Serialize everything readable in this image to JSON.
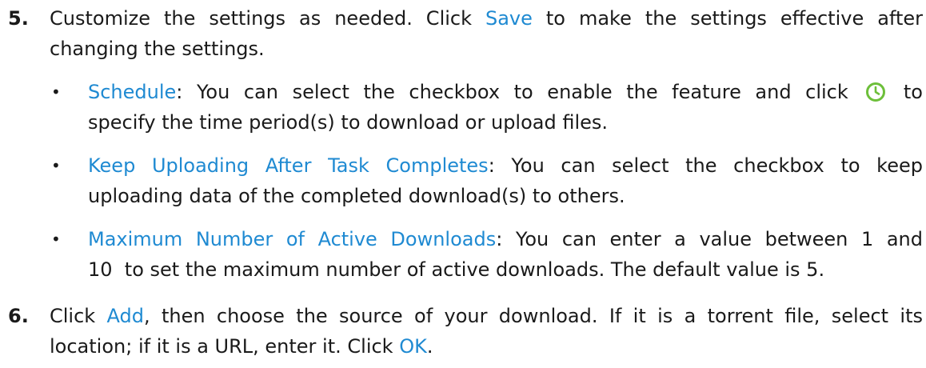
{
  "step5": {
    "number": "5.",
    "line1_a": "Customize the settings as needed. Click ",
    "line1_link": "Save",
    "line1_b": " to make the settings effective after",
    "line2": "changing the settings."
  },
  "bullets": [
    {
      "label": "Schedule",
      "line1_a": ": You can select the checkbox to enable the feature and click ",
      "icon": "clock-icon",
      "line1_b": " to",
      "line2": "specify the time period(s) to download or upload files."
    },
    {
      "label": "Keep Uploading After Task Completes",
      "line1_a": ": You can select the checkbox to keep",
      "line2": "uploading data of the completed download(s) to others."
    },
    {
      "label": "Maximum Number of Active Downloads",
      "line1_a": ": You can enter a value between 1 and",
      "line2": "10  to set the maximum number of active downloads. The default value is 5."
    }
  ],
  "step6": {
    "number": "6.",
    "line1_a": "Click ",
    "line1_link": "Add",
    "line1_b": ", then choose the source of your download. If it is a torrent file, select its",
    "line2_a": "location; if it is a URL, enter it. Click ",
    "line2_link": "OK",
    "line2_b": "."
  },
  "colors": {
    "link": "#1f8ad2",
    "icon": "#6dbf3a",
    "text": "#1a1a1a"
  }
}
